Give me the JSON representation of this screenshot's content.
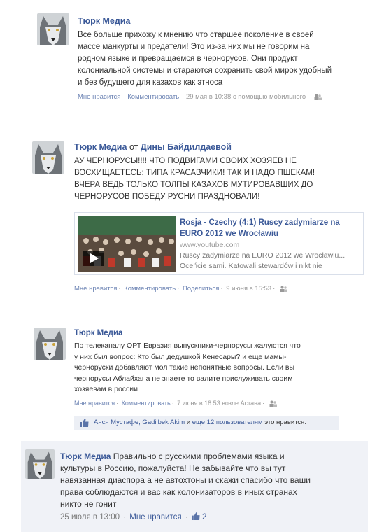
{
  "posts": [
    {
      "author": "Тюрк Медиа",
      "lines": [
        "Все больше прихожу к мнению что старшее поколение в своей",
        "массе манкурты и предатели! Это из-за них мы не говорим на",
        "родном языке и превращаемся в черноруcов. Они продукт",
        "колониальной системы и стараются сохранить свой мирок удобный",
        "и без будущего для казахов как этноса"
      ],
      "like": "Мне нравится",
      "comment": "Комментировать",
      "time": "29 мая в 10:38 с помощью мобильного"
    },
    {
      "author": "Тюрк Медиа",
      "from_word": "от",
      "from_author": "Дины Байдилдаевой",
      "lines": [
        "АУ ЧЕРНОРУСЫ!!!! ЧТО ПОДВИГАМИ СВОИХ ХОЗЯЕВ НЕ",
        "ВОСХИЩАЕТЕСЬ: ТИПА КРАСАВЧИКИ! ТАК И НАДО ПШЕКАМ!",
        "ВЧЕРА ВЕДЬ ТОЛЬКО ТОЛПЫ КАЗАХОВ МУТИРОВАВШИХ ДО",
        "ЧЕРНОРУСОВ ПОБЕДУ РУСНИ ПРАЗДНОВАЛИ!"
      ],
      "share": {
        "title_lines": [
          "Rosja - Czechy (4:1) Ruscy zadymiarze na",
          "EURO 2012 we Wrocławiu"
        ],
        "domain": "www.youtube.com",
        "desc_lines": [
          "Ruscy zadymiarze na EURO 2012 we Wrocławiu...",
          "Oceńcie sami. Katowali stewardów i nikt nie"
        ]
      },
      "like": "Мне нравится",
      "comment": "Комментировать",
      "share_label": "Поделиться",
      "time": "9 июня в 15:53"
    },
    {
      "author": "Тюрк Медиа",
      "lines": [
        "По телеканалу ОРТ Евразия выпускники-черноруcы жалуются что",
        "у них был вопрос: Кто был дедушкой Кенесары? и еще мамы-",
        "черноруски добавляют мол такие непонятные вопросы. Если вы",
        "черноруcы Аблайхана не знаете то валите прислуживать своим",
        "хозяевам в россии"
      ],
      "like": "Мне нравится",
      "comment": "Комментировать",
      "time": "7 июня в 18:53 возле Астана",
      "likes_bar": {
        "names": "Анся Мустафе, Gadilbek Akim",
        "and": "и",
        "others": "еще 12 пользователям",
        "suffix": "это нравится."
      }
    },
    {
      "author": "Тюрк Медиа",
      "first_line_rest": "Правильно с русскими проблемами языка и",
      "lines": [
        "культуры в Россию, пожалуйста! Не забывайте что вы тут",
        "навязанная диаспора а не автохтоны и скажи спасибо что ваши",
        "права соблюдаются и вас как колонизаторов в иных странах",
        "никто не гонит"
      ],
      "time": "25 июля в 13:00",
      "like": "Мне нравится",
      "like_count": "2"
    }
  ]
}
